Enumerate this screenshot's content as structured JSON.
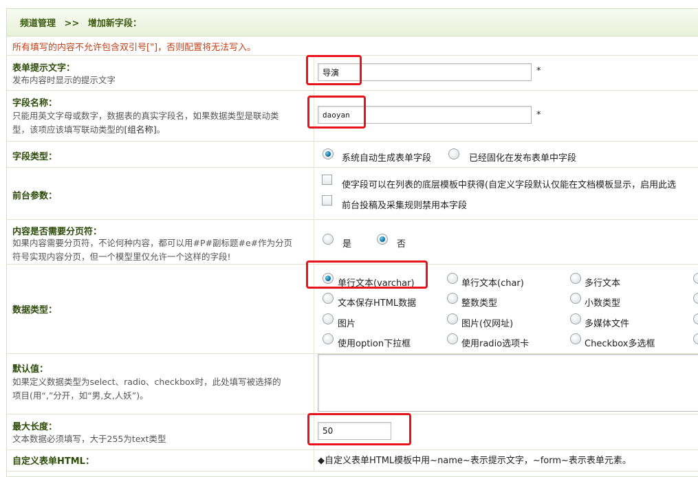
{
  "breadcrumb": {
    "section": "频道管理",
    "sep": ">>",
    "page": "增加新字段："
  },
  "warning": "所有填写的内容不允许包含双引号[\"]，否则配置将无法写入。",
  "fields": {
    "tip": {
      "label": "表单提示文字：",
      "desc": "发布内容时显示的提示文字",
      "value": "导演",
      "star": "*"
    },
    "name": {
      "label": "字段名称：",
      "desc1": "只能用英文字母或数字，数据表的真实字段名，如果数据类型是联动类",
      "desc2": "型，该项应该填写联动类型的",
      "desc_link": "[组名称]",
      "desc3": "。",
      "value": "daoyan",
      "star": "*"
    },
    "ftype": {
      "label": "字段类型：",
      "opt1": "系统自动生成表单字段",
      "opt2": "已经固化在发布表单中字段"
    },
    "front": {
      "label": "前台参数：",
      "opt1": "使字段可以在列表的底层模板中获得(自定义字段默认仅能在文档模板显示，启用此选",
      "opt2": "前台投稿及采集规则禁用本字段"
    },
    "paging": {
      "label": "内容是否需要分页符：",
      "desc1": "如果内容需要分页符，不论何种内容，都可以用#P#副标题#e#作为分页",
      "desc2": "符号实现内容分页，但一个模型里仅允许一个这样的字段!",
      "yes": "是",
      "no": "否"
    },
    "dtype": {
      "label": "数据类型：",
      "options": [
        [
          "单行文本(varchar)",
          "单行文本(char)",
          "多行文本"
        ],
        [
          "文本保存HTML数据",
          "整数类型",
          "小数类型"
        ],
        [
          "图片",
          "图片(仅网址)",
          "多媒体文件"
        ],
        [
          "使用option下拉框",
          "使用radio选项卡",
          "Checkbox多选框"
        ]
      ]
    },
    "default": {
      "label": "默认值：",
      "desc1": "如果定义数据类型为select、radio、checkbox时，此处填写被选择的",
      "desc2": "项目(用“,”分开，如“男,女,人妖”)。"
    },
    "maxlen": {
      "label": "最大长度：",
      "desc": "文本数据必须填写，大于255为text类型",
      "value": "50"
    },
    "custom": {
      "label": "自定义表单HTML：",
      "desc": "◆自定义表单HTML模板中用~name~表示提示文字，~form~表示表单元素。"
    }
  }
}
